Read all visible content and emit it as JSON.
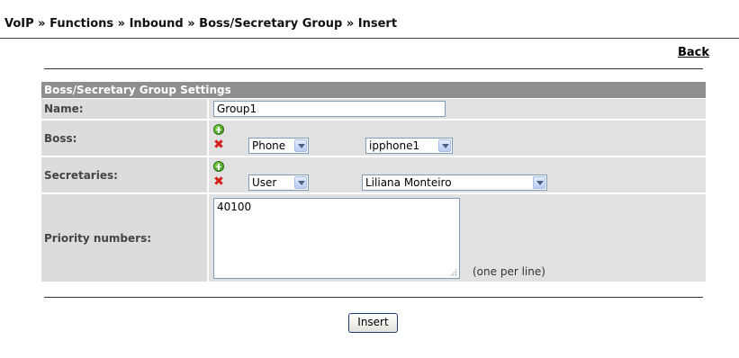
{
  "breadcrumb": "VoIP » Functions » Inbound » Boss/Secretary Group » Insert",
  "back_link": "Back",
  "panel": {
    "title": "Boss/Secretary Group Settings",
    "name": {
      "label": "Name:",
      "value": "Group1"
    },
    "boss": {
      "label": "Boss:",
      "type_select": "Phone",
      "target_select": "ipphone1"
    },
    "secretaries": {
      "label": "Secretaries:",
      "type_select": "User",
      "target_select": "Liliana Monteiro"
    },
    "priority": {
      "label": "Priority numbers:",
      "value": "40100",
      "hint": "(one per line)"
    }
  },
  "insert_button": "Insert",
  "icons": {
    "add": "add-icon",
    "remove": "delete-icon"
  },
  "colors": {
    "header_bg": "#8f8f8f",
    "row_bg": "#e1e1e1",
    "add_green": "#2f8a16",
    "delete_red": "#d3201b"
  }
}
